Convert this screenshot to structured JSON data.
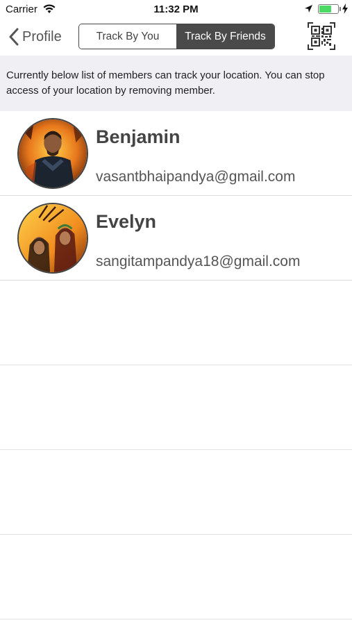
{
  "status_bar": {
    "carrier": "Carrier",
    "time": "11:32 PM",
    "icons": [
      "wifi-icon",
      "location-arrow-icon",
      "battery-icon",
      "charging-bolt-icon"
    ],
    "battery_color": "#4cd964"
  },
  "nav": {
    "back_label": "Profile",
    "segments": [
      "Track By You",
      "Track By Friends"
    ],
    "selected_segment": "Track By Friends",
    "qr_icon": "qr-code-icon"
  },
  "info": {
    "text": "Currently below list of members can track your location. You can stop access of your location by removing member."
  },
  "members": [
    {
      "name": "Benjamin",
      "email": "vasantbhaipandya@gmail.com"
    },
    {
      "name": "Evelyn",
      "email": "sangitampandya18@gmail.com"
    }
  ],
  "colors": {
    "selected_segment_bg": "#4a4a4a",
    "banner_bg": "#efeff4"
  }
}
